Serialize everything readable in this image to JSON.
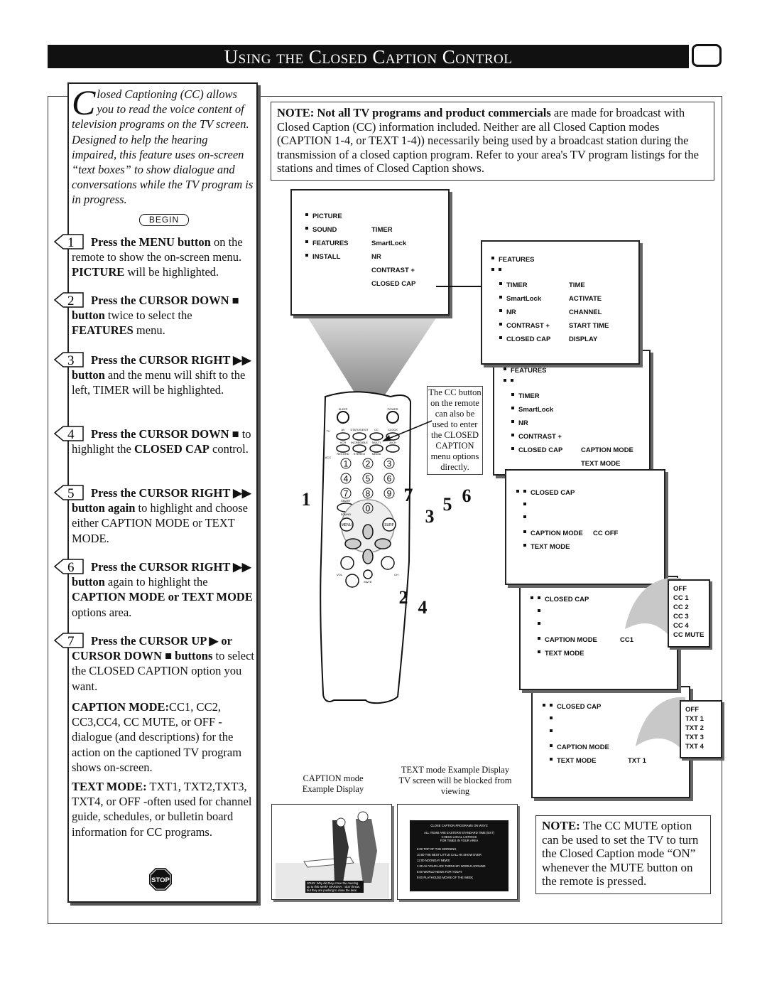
{
  "header": {
    "title": "Using the Closed Caption Control",
    "icon": "tv-screen-icon"
  },
  "intro": {
    "dropcap": "C",
    "text": "losed Captioning (CC) allows you to read the voice content of television programs on the TV screen. Designed to help the hearing impaired, this feature uses on-screen “text boxes” to show dialogue and conversations while the TV program is in progress.",
    "begin": "BEGIN"
  },
  "steps": [
    {
      "num": "1",
      "segments": [
        {
          "t": "Press the MENU button",
          "b": true
        },
        {
          "t": " on the remote to show the on-screen menu. ",
          "b": false
        },
        {
          "t": "PICTURE",
          "b": true
        },
        {
          "t": " will be highlighted.",
          "b": false
        }
      ]
    },
    {
      "num": "2",
      "segments": [
        {
          "t": "Press the CURSOR DOWN ■ button",
          "b": true
        },
        {
          "t": " twice to select the ",
          "b": false
        },
        {
          "t": "FEATURES",
          "b": true
        },
        {
          "t": " menu.",
          "b": false
        }
      ]
    },
    {
      "num": "3",
      "segments": [
        {
          "t": "Press the CURSOR RIGHT ▶▶ button",
          "b": true
        },
        {
          "t": " and the menu will shift to the left, TIMER will be highlighted.",
          "b": false
        }
      ]
    },
    {
      "num": "4",
      "segments": [
        {
          "t": "Press the CURSOR DOWN ■",
          "b": true
        },
        {
          "t": " to highlight the ",
          "b": false
        },
        {
          "t": "CLOSED CAP",
          "b": true
        },
        {
          "t": " control.",
          "b": false
        }
      ]
    },
    {
      "num": "5",
      "segments": [
        {
          "t": "Press the CURSOR RIGHT ▶▶ button again",
          "b": true
        },
        {
          "t": " to highlight and choose either CAPTION MODE or TEXT MODE.",
          "b": false
        }
      ]
    },
    {
      "num": "6",
      "segments": [
        {
          "t": "Press the CURSOR RIGHT ▶▶ button",
          "b": true
        },
        {
          "t": " again to highlight the ",
          "b": false
        },
        {
          "t": "CAPTION MODE or TEXT MODE",
          "b": true
        },
        {
          "t": " options area.",
          "b": false
        }
      ]
    },
    {
      "num": "7",
      "segments": [
        {
          "t": "Press the CURSOR UP ▶ or CURSOR DOWN ■ buttons",
          "b": true
        },
        {
          "t": " to select the CLOSED CAPTION option you want.",
          "b": false
        }
      ]
    }
  ],
  "caption_mode_para": [
    {
      "t": "CAPTION MODE:",
      "b": true
    },
    {
      "t": "CC1, CC2, CC3,CC4, CC MUTE, or OFF -dialogue (and descriptions) for the action on the captioned TV program shows on-screen.",
      "b": false
    }
  ],
  "text_mode_para": [
    {
      "t": "TEXT MODE:",
      "b": true
    },
    {
      "t": " TXT1, TXT2,TXT3, TXT4, or OFF -often used for channel guide, schedules, or bulletin board information for CC programs.",
      "b": false
    }
  ],
  "stop": "STOP",
  "note_top": {
    "bold": "NOTE: Not all TV programs and product commercials",
    "text": " are made for broadcast with Closed Caption (CC) information included. Neither are all Closed Caption modes (CAPTION 1-4, or TEXT 1-4)) necessarily being used by a broadcast station during the transmission of a closed caption program. Refer to your area's TV program listings for the stations and times of Closed Caption shows."
  },
  "note_bottom": {
    "bold": "NOTE:",
    "text": " The CC MUTE option can be used to set the TV to turn the Closed Caption mode “ON” whenever the MUTE button on the remote is pressed."
  },
  "callout": "The CC button on the remote can also be used to enter the CLOSED CAPTION menu options directly.",
  "menus": {
    "main": {
      "col1": [
        "PICTURE",
        "SOUND",
        "FEATURES",
        "INSTALL"
      ],
      "col2": [
        "TIMER",
        "SmartLock",
        "NR",
        "CONTRAST +",
        "CLOSED CAP"
      ]
    },
    "features": {
      "title": "FEATURES",
      "col1": [
        "TIMER",
        "SmartLock",
        "NR",
        "CONTRAST +",
        "CLOSED CAP"
      ],
      "col2": [
        "TIME",
        "ACTIVATE",
        "CHANNEL",
        "START TIME",
        "DISPLAY"
      ]
    },
    "features2": {
      "title": "FEATURES",
      "col1": [
        "TIMER",
        "SmartLock",
        "NR",
        "CONTRAST +",
        "CLOSED CAP"
      ],
      "col2": [
        "CAPTION MODE",
        "TEXT MODE"
      ]
    },
    "cc1": {
      "title": "CLOSED CAP",
      "items": [
        "CAPTION MODE",
        "TEXT MODE"
      ],
      "value": "CC OFF"
    },
    "cc2": {
      "title": "CLOSED CAP",
      "items": [
        "CAPTION MODE",
        "TEXT MODE"
      ],
      "value": "CC1",
      "options": [
        "OFF",
        "CC 1",
        "CC 2",
        "CC 3",
        "CC 4",
        "CC MUTE"
      ]
    },
    "cc3": {
      "title": "CLOSED CAP",
      "items": [
        "CAPTION MODE",
        "TEXT MODE"
      ],
      "value": "TXT 1",
      "options": [
        "OFF",
        "TXT 1",
        "TXT 2",
        "TXT 3",
        "TXT 4"
      ]
    }
  },
  "remote": {
    "buttons": [
      "SLEEP",
      "POWER",
      "TV",
      "AV",
      "STATUS/EXIT",
      "CC",
      "CLOCK",
      "VCR",
      "INCREDIBLE",
      "MULTI",
      "A/CH",
      "ACC",
      "RECORD",
      "STEREO",
      "MEDIA",
      "SMART",
      "SOUND",
      "MENU",
      "SURF",
      "VOL",
      "CH",
      "MUTE"
    ],
    "digits": [
      "1",
      "2",
      "3",
      "4",
      "5",
      "6",
      "7",
      "8",
      "9",
      "0"
    ],
    "step_tags": [
      "1",
      "7",
      "3",
      "5",
      "6",
      "2",
      "4"
    ]
  },
  "captions": {
    "caption_mode": "CAPTION mode Example Display",
    "text_mode": "TEXT  mode Example Display TV screen will be blocked from viewing"
  },
  "caption_example": {
    "subtitle": "JOHN: Why did they move the meeting up to this week? MARSHA: I don't know, but they are pushing to close the deal."
  },
  "text_example": {
    "head": "CLOSE CAPTION PROGRAMS ON WXYZ",
    "sub": [
      "ALL ITEMS ARE EASTERN STANDARD TIME (EST)",
      "CHECK LOCAL LISTINGS",
      "FOR TIMES IN YOUR AREA"
    ],
    "rows": [
      "6:00   TOP OF THE MORNING",
      "10:00   THE BEST LITTLE CALL-IN SHOW EVER",
      "12:00   NOONDAY NEWS",
      "1:30   AS YOUR LIFE TURNS MY WORLD AROUND",
      "6:00   WORLD NEWS FOR TODAY",
      "9:00   PLAYHOUSE MOVIE OF THE WEEK"
    ]
  }
}
